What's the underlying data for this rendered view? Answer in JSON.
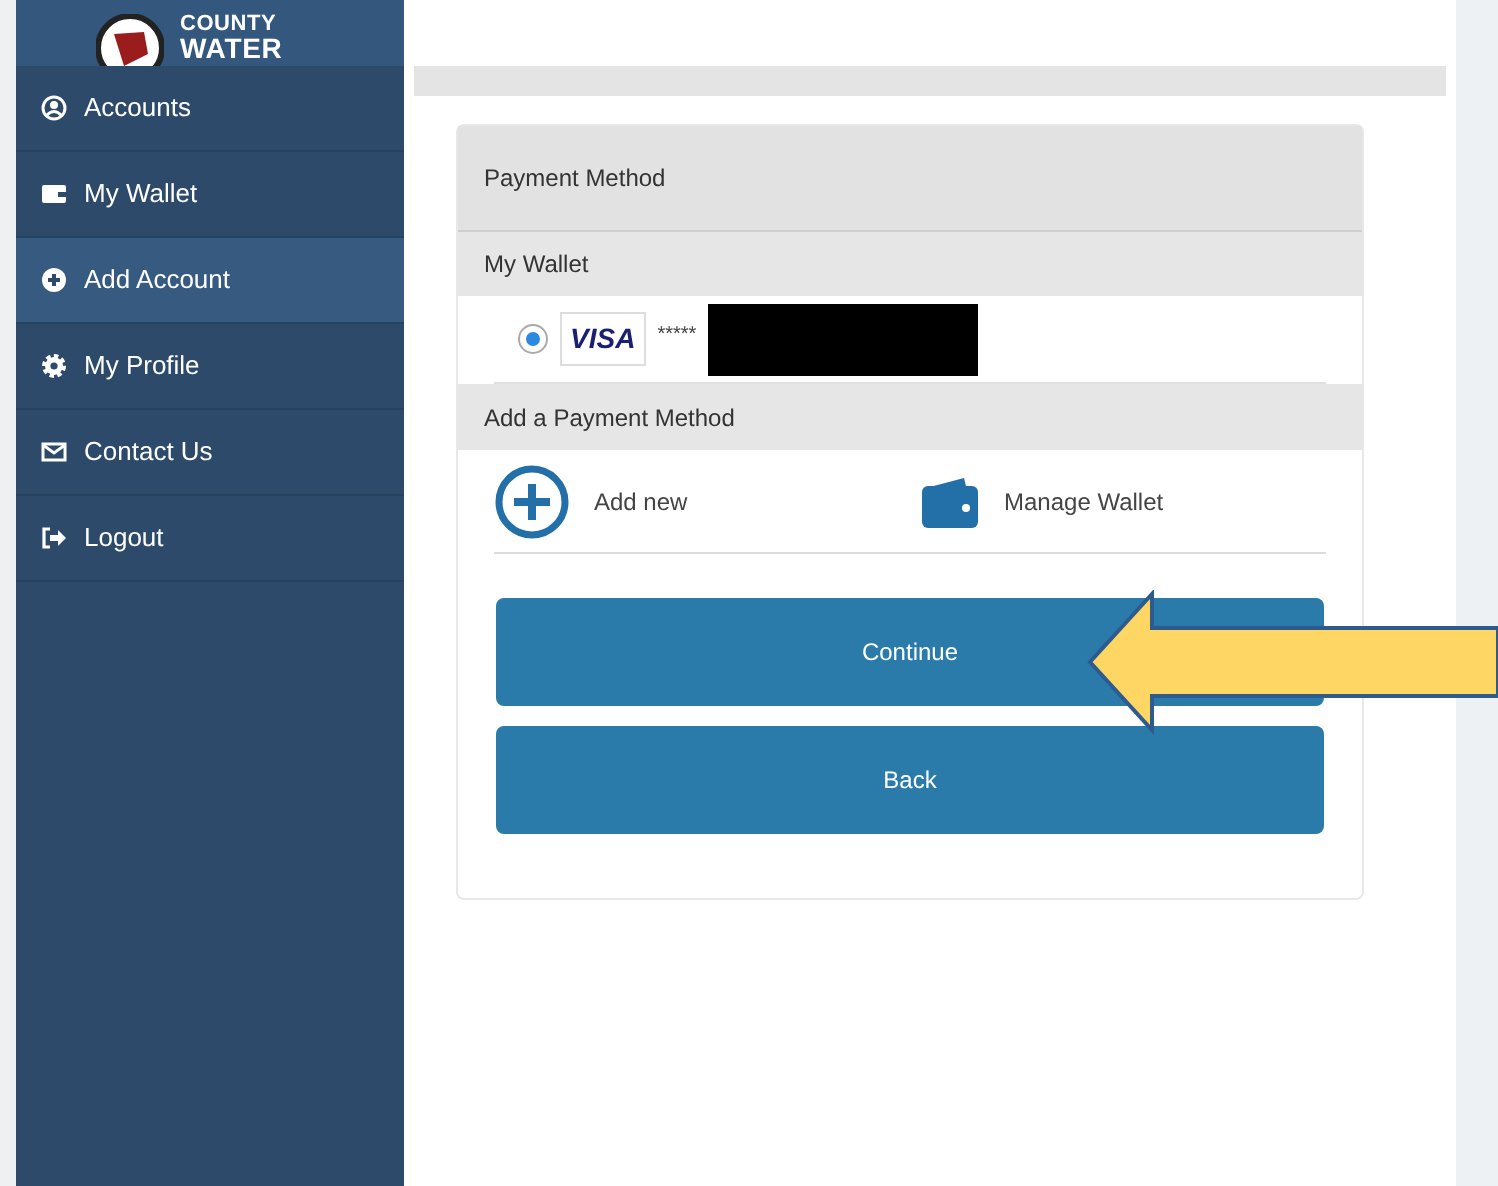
{
  "logo": {
    "line_1": "COUNTY",
    "line_2": "WATER"
  },
  "sidebar": {
    "items": [
      {
        "label": "Accounts",
        "kind": "user",
        "selected": false
      },
      {
        "label": "My Wallet",
        "kind": "wallet",
        "selected": false
      },
      {
        "label": "Add Account",
        "kind": "plus",
        "selected": true
      },
      {
        "label": "My Profile",
        "kind": "gear",
        "selected": false
      },
      {
        "label": "Contact Us",
        "kind": "mail",
        "selected": false
      },
      {
        "label": "Logout",
        "kind": "logout",
        "selected": false
      }
    ]
  },
  "payment": {
    "title": "Payment Method",
    "wallet_heading": "My Wallet",
    "cards": [
      {
        "brand": "VISA",
        "masked": "*****",
        "selected": true
      }
    ],
    "add_heading": "Add a Payment Method",
    "actions": [
      {
        "label": "Add new",
        "kind": "plus"
      },
      {
        "label": "Manage Wallet",
        "kind": "wallet"
      }
    ],
    "buttons": [
      "Continue",
      "Back"
    ]
  }
}
